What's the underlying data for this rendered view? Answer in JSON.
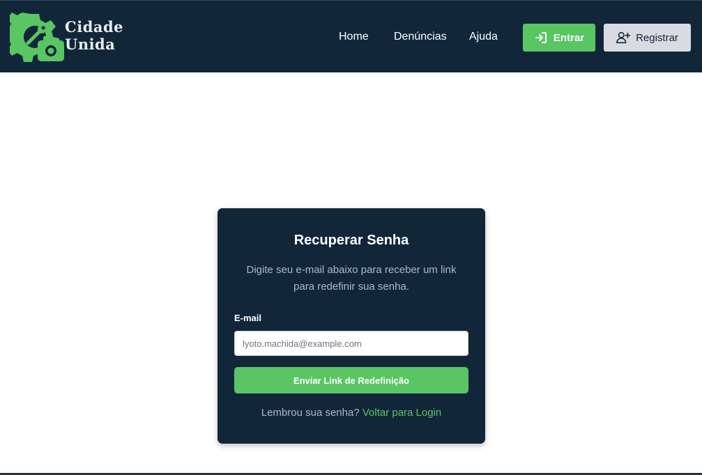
{
  "brand": {
    "line1": "Cidade",
    "line2": "Unida",
    "logo_icon": "gear-wrench-camera-icon",
    "accent_color": "#59c563"
  },
  "nav": {
    "links": [
      {
        "label": "Home"
      },
      {
        "label": "Denúncias"
      },
      {
        "label": "Ajuda"
      }
    ],
    "login_label": "Entrar",
    "login_icon": "sign-in-icon",
    "register_label": "Registrar",
    "register_icon": "user-plus-icon"
  },
  "card": {
    "title": "Recuperar Senha",
    "description": "Digite seu e-mail abaixo para receber um link para redefinir sua senha.",
    "email_label": "E-mail",
    "email_placeholder": "lyoto.machida@example.com",
    "email_value": "",
    "submit_label": "Enviar Link de Redefinição",
    "footer_text": "Lembrou sua senha? ",
    "footer_link": "Voltar para Login"
  },
  "colors": {
    "navbar_bg": "#12263a",
    "card_bg": "#12263a",
    "primary_green": "#59c563",
    "secondary_button": "#d8dbe0"
  }
}
